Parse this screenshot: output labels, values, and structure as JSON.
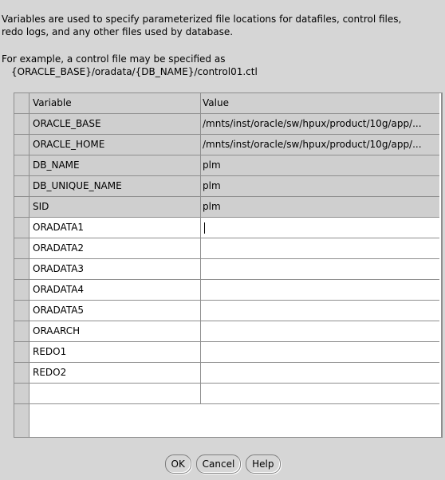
{
  "description": {
    "line1": "Variables are used to specify parameterized file locations for datafiles, control files,",
    "line2": "redo logs, and any other files used by database.",
    "example_line1": "For example, a control file may be specified as",
    "example_line2": "{ORACLE_BASE}/oradata/{DB_NAME}/control01.ctl"
  },
  "table": {
    "columns": [
      "Variable",
      "Value"
    ],
    "rows": [
      {
        "variable": "ORACLE_BASE",
        "value": "/mnts/inst/oracle/sw/hpux/product/10g/app/..."
      },
      {
        "variable": "ORACLE_HOME",
        "value": "/mnts/inst/oracle/sw/hpux/product/10g/app/..."
      },
      {
        "variable": "DB_NAME",
        "value": "plm"
      },
      {
        "variable": "DB_UNIQUE_NAME",
        "value": "plm"
      },
      {
        "variable": "SID",
        "value": "plm"
      },
      {
        "variable": "ORADATA1",
        "value": ""
      },
      {
        "variable": "ORADATA2",
        "value": ""
      },
      {
        "variable": "ORADATA3",
        "value": ""
      },
      {
        "variable": "ORADATA4",
        "value": ""
      },
      {
        "variable": "ORADATA5",
        "value": ""
      },
      {
        "variable": "ORAARCH",
        "value": ""
      },
      {
        "variable": "REDO1",
        "value": ""
      },
      {
        "variable": "REDO2",
        "value": ""
      },
      {
        "variable": "",
        "value": ""
      }
    ]
  },
  "buttons": {
    "ok": "OK",
    "cancel": "Cancel",
    "help": "Help"
  },
  "colors": {
    "background": "#d6d6d6",
    "readonly_cell": "#cfcfcf",
    "editable_cell": "#ffffff",
    "grid_line": "#8e8e8e"
  }
}
